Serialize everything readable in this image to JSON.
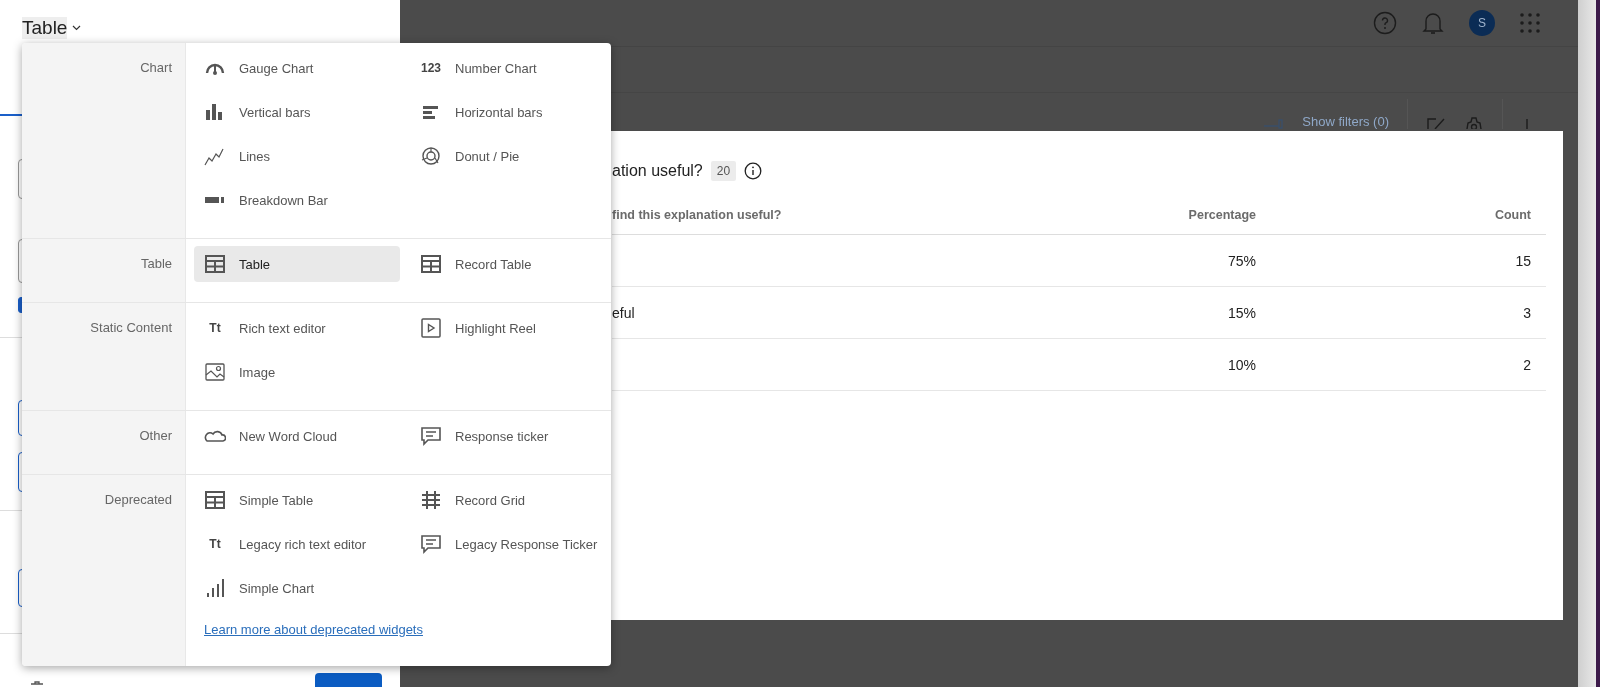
{
  "title": "Table",
  "left_panel": {
    "checkbox": {
      "checked": true
    }
  },
  "menu": {
    "sections": [
      {
        "category": "Chart",
        "items": [
          {
            "label": "Gauge Chart",
            "selected": false
          },
          {
            "label": "Number Chart",
            "icon_text": "123",
            "selected": false
          },
          {
            "label": "Vertical bars",
            "selected": false
          },
          {
            "label": "Horizontal bars",
            "selected": false
          },
          {
            "label": "Lines",
            "selected": false
          },
          {
            "label": "Donut / Pie",
            "selected": false
          },
          {
            "label": "Breakdown Bar",
            "selected": false
          }
        ]
      },
      {
        "category": "Table",
        "items": [
          {
            "label": "Table",
            "selected": true
          },
          {
            "label": "Record Table",
            "selected": false
          }
        ]
      },
      {
        "category": "Static Content",
        "items": [
          {
            "label": "Rich text editor",
            "icon_text": "Tt",
            "selected": false
          },
          {
            "label": "Highlight Reel",
            "selected": false
          },
          {
            "label": "Image",
            "selected": false
          }
        ]
      },
      {
        "category": "Other",
        "items": [
          {
            "label": "New Word Cloud",
            "selected": false
          },
          {
            "label": "Response ticker",
            "selected": false
          }
        ]
      },
      {
        "category": "Deprecated",
        "items": [
          {
            "label": "Simple Table",
            "selected": false
          },
          {
            "label": "Record Grid",
            "selected": false
          },
          {
            "label": "Legacy rich text editor",
            "icon_text": "Tt",
            "selected": false
          },
          {
            "label": "Legacy Response Ticker",
            "selected": false
          },
          {
            "label": "Simple Chart",
            "selected": false
          }
        ]
      }
    ],
    "link": "Learn more about deprecated widgets"
  },
  "top_bar": {
    "avatar": "S"
  },
  "toolbar": {
    "filters": "Show filters (0)"
  },
  "card": {
    "title": "ation useful?",
    "count": "20",
    "columns": [
      "find this explanation useful?",
      "Percentage",
      "Count"
    ],
    "rows": [
      {
        "percentage": "75%",
        "count": "15"
      },
      {
        "label": "eful",
        "percentage": "15%",
        "count": "3"
      },
      {
        "percentage": "10%",
        "count": "2"
      }
    ]
  }
}
